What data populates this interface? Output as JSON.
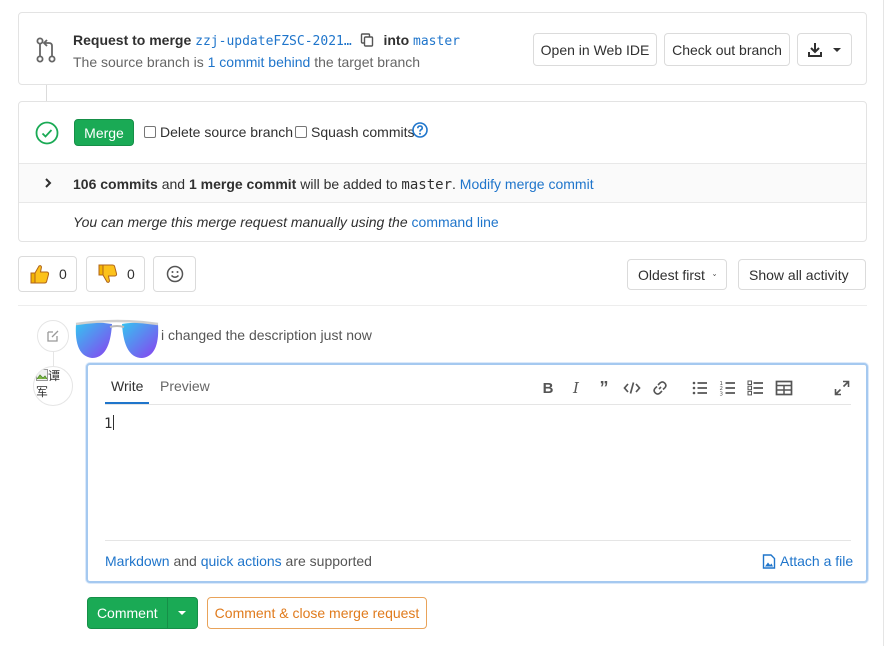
{
  "colors": {
    "link": "#1f75cb",
    "merge_green": "#1aaa55",
    "warning_orange": "#e07b1d",
    "focus_border": "#a5c9f0"
  },
  "mr_header": {
    "request_to_merge": "Request to merge",
    "source_branch": "zzj-updateFZSC-2021…",
    "into": "into",
    "target_branch": "master",
    "sub_prefix": "The source branch is ",
    "behind_link": "1 commit behind",
    "sub_suffix": " the target branch",
    "open_web_ide": "Open in Web IDE",
    "check_out_branch": "Check out branch",
    "icons": {
      "merge_request": "merge-request-icon",
      "copy": "copy-icon",
      "download": "download-icon",
      "caret": "chevron-down-icon"
    }
  },
  "merge_widget": {
    "merge_button": "Merge",
    "delete_source_branch": "Delete source branch",
    "delete_source_checked": false,
    "squash_commits": "Squash commits",
    "squash_checked": false,
    "commits_count": "106 commits",
    "and": " and ",
    "merge_commit": "1 merge commit",
    "will_be_added": " will be added to ",
    "target": "master",
    "dot": ". ",
    "modify_link": "Modify merge commit",
    "manual_text": "You can merge this merge request manually using the ",
    "command_line_link": "command line"
  },
  "awards": {
    "thumbs_up_count": "0",
    "thumbs_down_count": "0"
  },
  "sort": {
    "order": "Oldest first",
    "filter": "Show all activity"
  },
  "timeline": {
    "note_visible_fragment": "i changed the description just now"
  },
  "comment_form": {
    "avatar_alt_line1": "谭",
    "avatar_alt_line2": "军",
    "tab_write": "Write",
    "tab_preview": "Preview",
    "toolbar": [
      "bold",
      "italic",
      "quote",
      "code",
      "link",
      "bullet-list",
      "numbered-list",
      "task-list",
      "table",
      "fullscreen"
    ],
    "textarea_value": "1",
    "markdown_link": "Markdown",
    "and": " and ",
    "quick_actions_link": "quick actions",
    "supported": " are supported",
    "attach_file": "Attach a file"
  },
  "actions": {
    "comment": "Comment",
    "comment_close": "Comment & close merge request"
  }
}
